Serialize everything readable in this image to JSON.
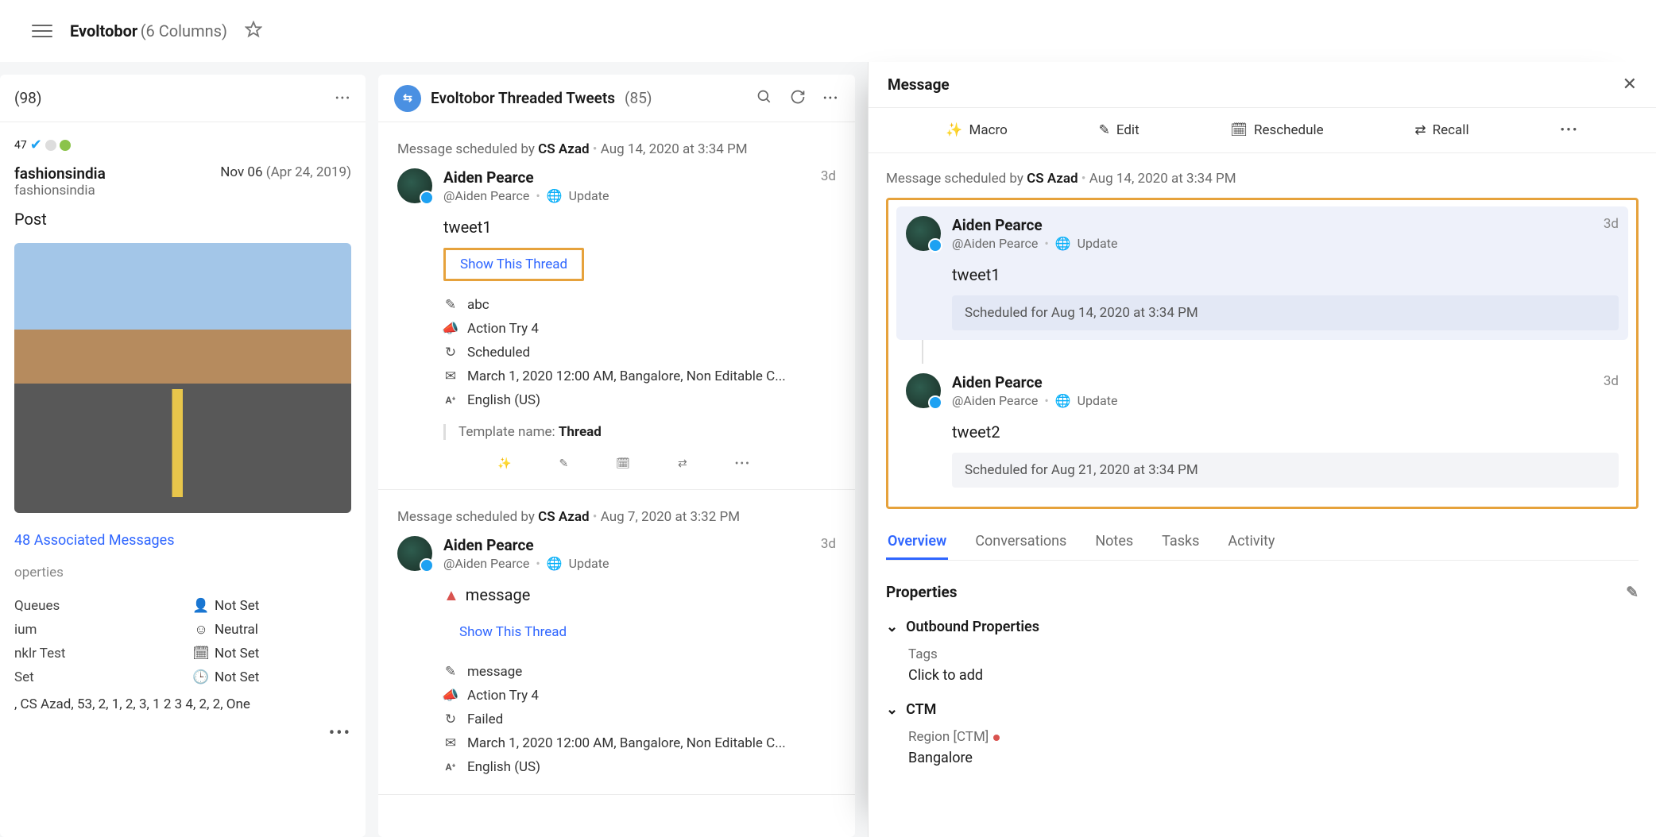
{
  "header": {
    "title": "Evoltobor",
    "columns_label": "(6 Columns)"
  },
  "col1": {
    "head_count": "(98)",
    "verified_num": "47",
    "profile_name": "fashionsindia",
    "profile_handle": "fashionsindia",
    "date": "Nov 06",
    "date_sub": "(Apr 24, 2019)",
    "post_label": "Post",
    "assoc_link": "48 Associated Messages",
    "properties_label": "operties",
    "props_left": [
      "Queues",
      "ium",
      "nklr Test",
      "Set"
    ],
    "props_right": [
      "Not Set",
      "Neutral",
      "Not Set",
      "Not Set"
    ],
    "tags_line": ", CS Azad, 53, 2, 1, 2, 3, 1 2 3 4, 2, 2, One"
  },
  "col2": {
    "title": "Evoltobor Threaded Tweets",
    "count": "(85)",
    "cards": [
      {
        "sched_prefix": "Message scheduled by",
        "sched_by": "CS Azad",
        "sched_at": "Aug 14, 2020 at 3:34 PM",
        "name": "Aiden Pearce",
        "handle": "@Aiden Pearce",
        "visibility": "Update",
        "age": "3d",
        "text": "tweet1",
        "show_thread": "Show This Thread",
        "show_boxed": true,
        "meta": {
          "note": "abc",
          "campaign": "Action Try 4",
          "status": "Scheduled",
          "detail": "March 1, 2020 12:00 AM, Bangalore, Non Editable C...",
          "lang": "English (US)",
          "template_label": "Template name:",
          "template": "Thread"
        }
      },
      {
        "sched_prefix": "Message scheduled by",
        "sched_by": "CS Azad",
        "sched_at": "Aug 7, 2020 at 3:32 PM",
        "name": "Aiden Pearce",
        "handle": "@Aiden Pearce",
        "visibility": "Update",
        "age": "3d",
        "text": "message",
        "warn": true,
        "show_thread": "Show This Thread",
        "show_boxed": false,
        "meta": {
          "note": "message",
          "campaign": "Action Try 4",
          "status": "Failed",
          "detail": "March 1, 2020 12:00 AM, Bangalore, Non Editable C...",
          "lang": "English (US)"
        }
      }
    ]
  },
  "panel": {
    "title": "Message",
    "actions": {
      "macro": "Macro",
      "edit": "Edit",
      "reschedule": "Reschedule",
      "recall": "Recall"
    },
    "sched_prefix": "Message scheduled by",
    "sched_by": "CS Azad",
    "sched_at": "Aug 14, 2020 at 3:34 PM",
    "thread": [
      {
        "name": "Aiden Pearce",
        "handle": "@Aiden Pearce",
        "visibility": "Update",
        "age": "3d",
        "text": "tweet1",
        "pill": "Scheduled for Aug 14, 2020 at 3:34 PM",
        "active": true
      },
      {
        "name": "Aiden Pearce",
        "handle": "@Aiden Pearce",
        "visibility": "Update",
        "age": "3d",
        "text": "tweet2",
        "pill": "Scheduled for Aug 21, 2020 at 3:34 PM",
        "active": false
      }
    ],
    "tabs": [
      "Overview",
      "Conversations",
      "Notes",
      "Tasks",
      "Activity"
    ],
    "properties_title": "Properties",
    "outbound_title": "Outbound Properties",
    "tags_label": "Tags",
    "tags_value": "Click to add",
    "ctm_title": "CTM",
    "region_label": "Region [CTM]",
    "region_value": "Bangalore"
  }
}
